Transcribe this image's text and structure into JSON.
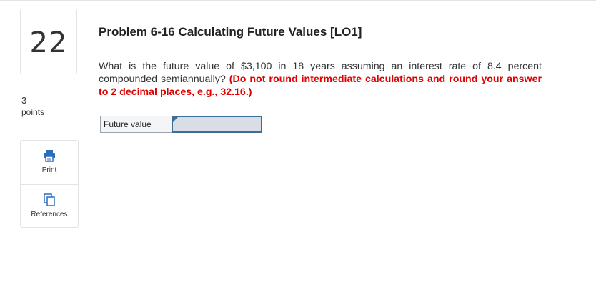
{
  "question": {
    "number": "22",
    "points_value": "3",
    "points_label": "points",
    "title": "Problem 6-16 Calculating Future Values [LO1]",
    "body": "What is the future value of $3,100 in 18 years assuming an interest rate of 8.4 percent compounded semiannually?",
    "instruction": "(Do not round intermediate calculations and round your answer to 2 decimal places, e.g., 32.16.)"
  },
  "tools": {
    "print_label": "Print",
    "references_label": "References",
    "print_icon": "printer-icon",
    "references_icon": "copy-pages-icon"
  },
  "answer": {
    "label": "Future value",
    "value": ""
  },
  "colors": {
    "emphasis": "#e00000",
    "input_border": "#3d6e96",
    "input_fill": "#d9dde6",
    "icon_blue": "#2a6ebb"
  }
}
